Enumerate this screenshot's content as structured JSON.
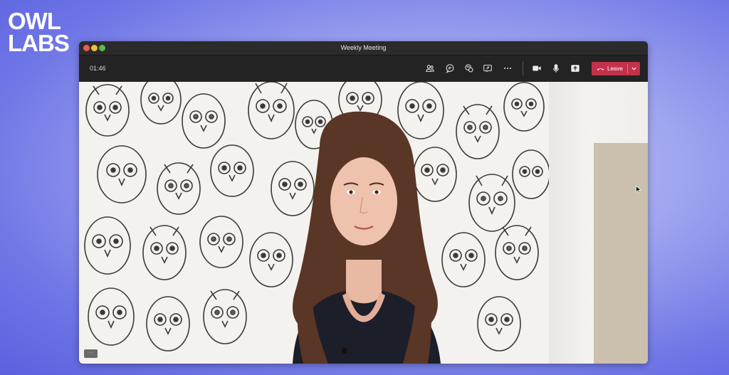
{
  "brand": {
    "line1": "OWL",
    "line2": "LABS"
  },
  "window": {
    "title": "Weekly Meeting"
  },
  "toolbar": {
    "timer": "01:46",
    "icons": [
      "people-icon",
      "chat-icon",
      "reactions-icon",
      "share-screen-icon",
      "more-icon",
      "camera-icon",
      "microphone-icon",
      "share-tray-icon"
    ],
    "leave_label": "Leave"
  },
  "video": {
    "corner_button": "···"
  },
  "colors": {
    "background": "#6f76e6",
    "window": "#1f1f1f",
    "leave": "#c4314b"
  }
}
